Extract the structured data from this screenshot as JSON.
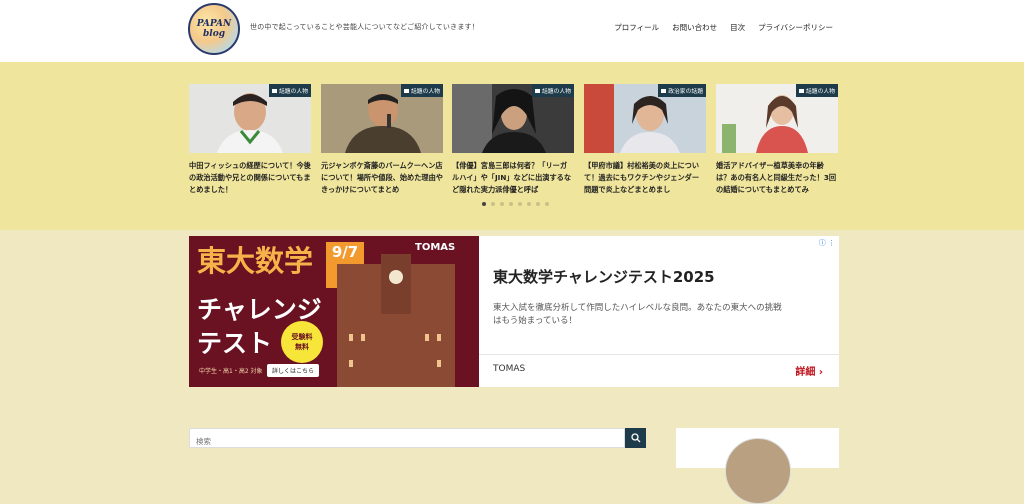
{
  "header": {
    "logo_line1": "PAPAN",
    "logo_line2": "blog",
    "tagline": "世の中で起こっていることや芸能人についてなどご紹介していきます！",
    "nav": [
      "プロフィール",
      "お問い合わせ",
      "目次",
      "プライバシーポリシー"
    ]
  },
  "carousel": {
    "cards": [
      {
        "tag": "話題の人物",
        "title": "中田フィッシュの経歴について！今後の政治活動や兄との関係についてもまとめました！"
      },
      {
        "tag": "話題の人物",
        "title": "元ジャンボケ斎藤のバームクーヘン店について！場所や値段、始めた理由やきっかけについてまとめ"
      },
      {
        "tag": "話題の人物",
        "title": "【俳優】宮島三郎は何者？「リーガルハイ」や「JIN」などに出演するなど隠れた実力派俳優と呼ば"
      },
      {
        "tag": "政治家の話題",
        "title": "【甲府市議】村松裕美の炎上について！過去にもワクチンやジェンダー問題で炎上などまとめまし"
      },
      {
        "tag": "話題の人物",
        "title": "婚活アドバイザー植草美幸の年齢は？あの有名人と同級生だった！3回の結婚についてもまとめてみ"
      }
    ],
    "dot_count": 8,
    "active_dot": 0
  },
  "ad": {
    "image_big1": "東大数学",
    "image_big2": "チャレンジ",
    "image_big3": "テスト",
    "image_date": "9/7",
    "image_badge1": "受験料",
    "image_badge2": "無料",
    "image_target": "中学生・高1・高2 対象",
    "image_btn": "詳しくはこちら",
    "image_brand": "TOMAS",
    "title": "東大数学チャレンジテスト2025",
    "description": "東大入試を徹底分析して作問したハイレベルな良問。あなたの東大への挑戦はもう始まっている！",
    "brand": "TOMAS",
    "more": "詳細"
  },
  "search": {
    "placeholder": "検索"
  }
}
